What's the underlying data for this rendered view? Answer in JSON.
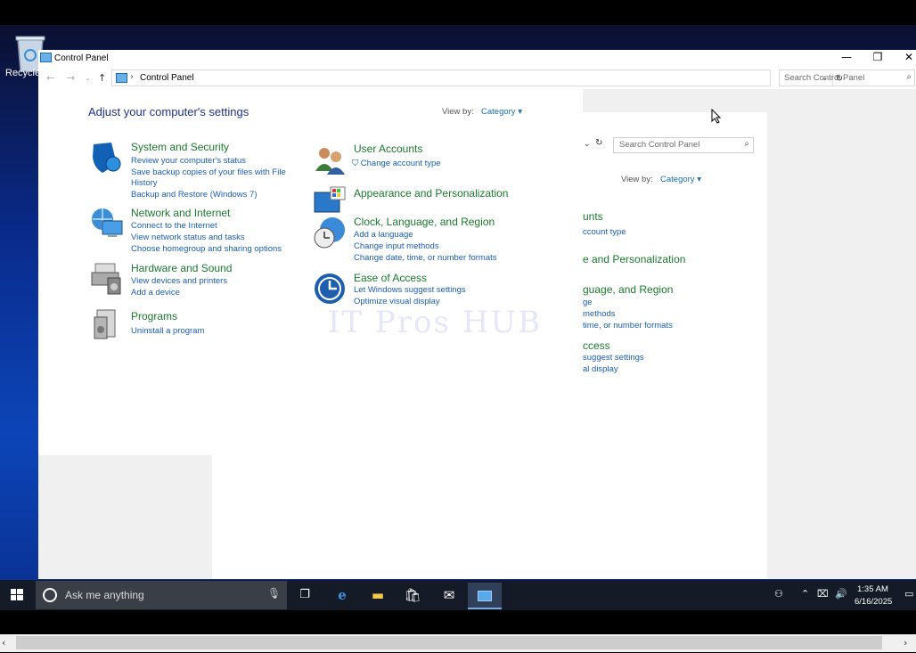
{
  "desktop": {
    "recycle_label": "Recycle"
  },
  "window": {
    "title": "Control Panel",
    "breadcrumb": "Control Panel",
    "search_placeholder": "Search Control Panel",
    "heading": "Adjust your computer's settings",
    "view_by_label": "View by:",
    "view_by_value": "Category"
  },
  "categories_left": [
    {
      "title": "System and Security",
      "links": [
        "Review your computer's status",
        "Save backup copies of your files with File",
        "History",
        "Backup and Restore (Windows 7)"
      ]
    },
    {
      "title": "Network and Internet",
      "links": [
        "Connect to the Internet",
        "View network status and tasks",
        "Choose homegroup and sharing options"
      ]
    },
    {
      "title": "Hardware and Sound",
      "links": [
        "View devices and printers",
        "Add a device"
      ]
    },
    {
      "title": "Programs",
      "links": [
        "Uninstall a program"
      ]
    }
  ],
  "categories_right": [
    {
      "title": "User Accounts",
      "links": [
        "Change account type"
      ]
    },
    {
      "title": "Appearance and Personalization",
      "links": []
    },
    {
      "title": "Clock, Language, and Region",
      "links": [
        "Add a language",
        "Change input methods",
        "Change date, time, or number formats"
      ]
    },
    {
      "title": "Ease of Access",
      "links": [
        "Let Windows suggest settings",
        "Optimize visual display"
      ]
    }
  ],
  "ghost": {
    "search_placeholder": "Search Control Panel",
    "view_by_label": "View by:",
    "view_by_value": "Category",
    "lines": [
      "unts",
      "ccount type",
      "e and Personalization",
      "guage, and Region",
      "ge",
      "methods",
      "time, or number formats",
      "ccess",
      "suggest settings",
      "al display"
    ]
  },
  "watermark": "IT Pros HUB",
  "taskbar": {
    "search_placeholder": "Ask me anything",
    "time": "1:35 AM",
    "date": "6/16/2025"
  },
  "colors": {
    "title_green": "#1a7a2e",
    "link_blue": "#1a5fb4",
    "heading_blue": "#1e3287",
    "taskbar": "#151b26"
  }
}
